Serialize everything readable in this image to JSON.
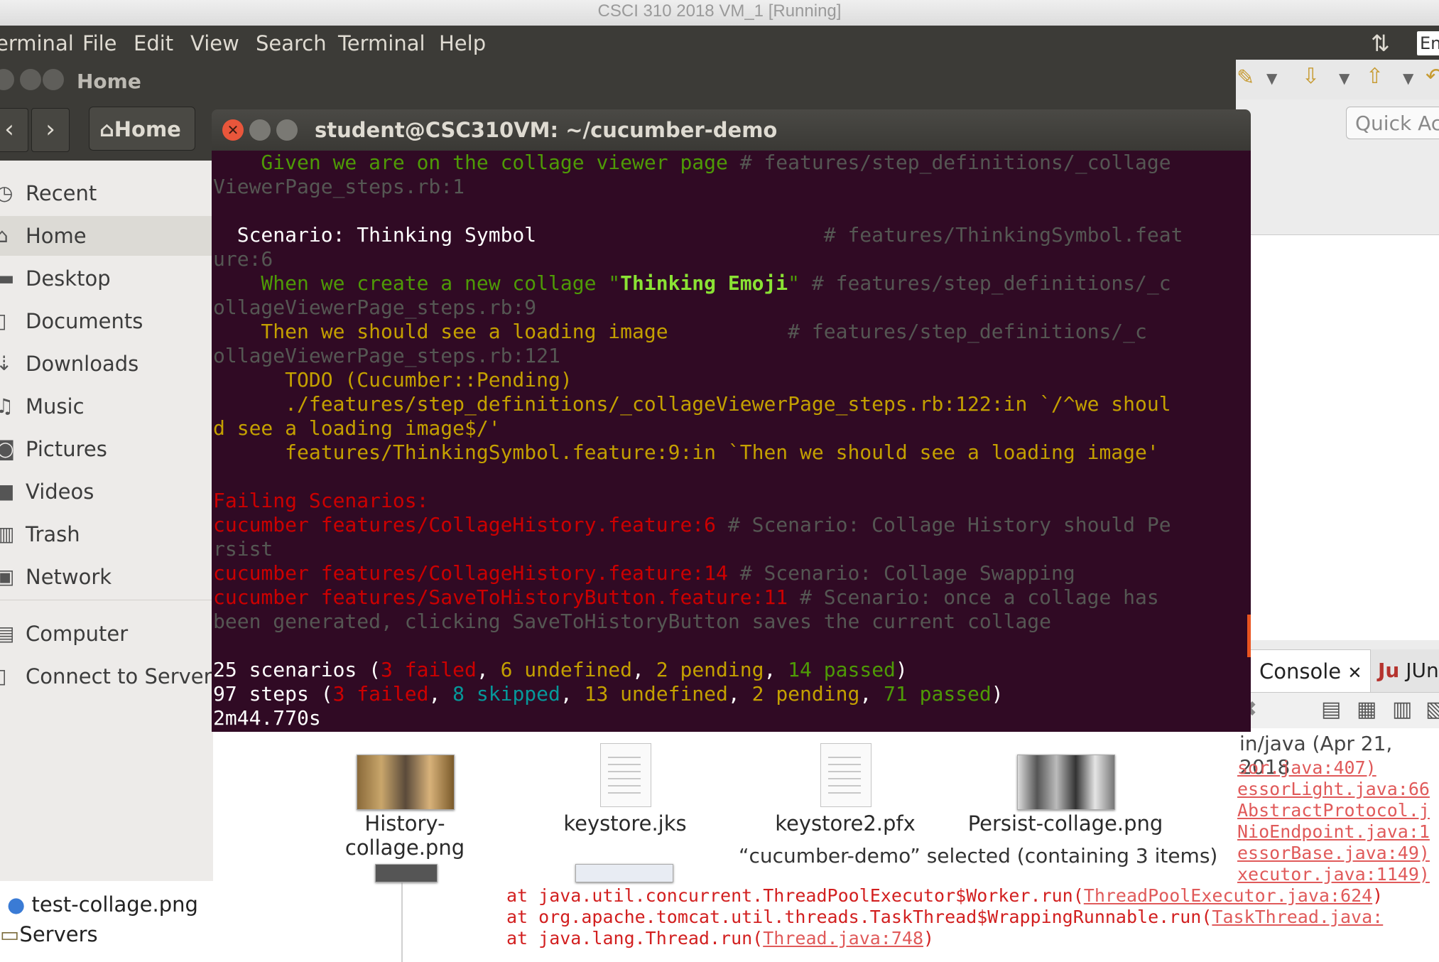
{
  "vm_title": "CSCI 310 2018 VM_1 [Running]",
  "menubar": {
    "items": [
      "erminal",
      "File",
      "Edit",
      "View",
      "Search",
      "Terminal",
      "Help"
    ],
    "keyboard_indicator": "En"
  },
  "nautilus": {
    "title": "Home",
    "breadcrumb": "Home",
    "sidebar": [
      {
        "label": "Recent",
        "icon": "clock-icon"
      },
      {
        "label": "Home",
        "icon": "home-icon",
        "active": true
      },
      {
        "label": "Desktop",
        "icon": "folder-icon"
      },
      {
        "label": "Documents",
        "icon": "document-icon"
      },
      {
        "label": "Downloads",
        "icon": "download-icon"
      },
      {
        "label": "Music",
        "icon": "music-icon"
      },
      {
        "label": "Pictures",
        "icon": "camera-icon"
      },
      {
        "label": "Videos",
        "icon": "video-icon"
      },
      {
        "label": "Trash",
        "icon": "trash-icon"
      },
      {
        "label": "Network",
        "icon": "network-icon"
      },
      {
        "label": "Computer",
        "icon": "computer-icon"
      },
      {
        "label": "Connect to Server",
        "icon": "server-icon"
      }
    ],
    "files": [
      "History-collage.png",
      "keystore.jks",
      "keystore2.pfx",
      "Persist-collage.png"
    ],
    "status": "“cucumber-demo” selected  (containing 3 items)"
  },
  "terminal": {
    "title": "student@CSC310VM: ~/cucumber-demo",
    "lines": {
      "l1a": "    Given we are on the collage viewer page ",
      "l1b": "# features/step_definitions/_collage",
      "l2": "ViewerPage_steps.rb:1",
      "l3a": "  Scenario: Thinking Symbol                        ",
      "l3b": "# features/ThinkingSymbol.feat",
      "l4": "ure:6",
      "l5a": "    When we create a new collage \"",
      "l5b": "Thinking Emoji",
      "l5c": "\" ",
      "l5d": "# features/step_definitions/_c",
      "l6": "ollageViewerPage_steps.rb:9",
      "l7a": "    Then we should see a loading image          ",
      "l7b": "# features/step_definitions/_c",
      "l8": "ollageViewerPage_steps.rb:121",
      "l9": "      TODO (Cucumber::Pending)",
      "l10": "      ./features/step_definitions/_collageViewerPage_steps.rb:122:in `/^we shoul",
      "l11": "d see a loading image$/'",
      "l12": "      features/ThinkingSymbol.feature:9:in `Then we should see a loading image'",
      "l13": "Failing Scenarios:",
      "l14a": "cucumber features/CollageHistory.feature:6 ",
      "l14b": "# Scenario: Collage History should Pe",
      "l15": "rsist",
      "l16a": "cucumber features/CollageHistory.feature:14 ",
      "l16b": "# Scenario: Collage Swapping",
      "l17a": "cucumber features/SaveToHistoryButton.feature:11 ",
      "l17b": "# Scenario: once a collage has",
      "l18": "been generated, clicking SaveToHistoryButton saves the current collage",
      "s1": "25 scenarios (",
      "s1_failed": "3 failed",
      "s1_sep1": ", ",
      "s1_undef": "6 undefined",
      "s1_sep2": ", ",
      "s1_pend": "2 pending",
      "s1_sep3": ", ",
      "s1_pass": "14 passed",
      "s1_end": ")",
      "s2": "97 steps (",
      "s2_failed": "3 failed",
      "s2_sep1": ", ",
      "s2_skip": "8 skipped",
      "s2_sep2": ", ",
      "s2_undef": "13 undefined",
      "s2_sep3": ", ",
      "s2_pend": "2 pending",
      "s2_sep4": ", ",
      "s2_pass": "71 passed",
      "s2_end": ")",
      "time": "2m44.770s"
    }
  },
  "eclipse": {
    "quick_access": "Quick Ac",
    "console_tab": "Console",
    "junit_tab": "JUn",
    "console_head": "in/java (Apr 21, 2018",
    "links": [
      "sor.java:407)",
      "essorLight.java:66",
      "AbstractProtocol.j",
      "NioEndpoint.java:1",
      "essorBase.java:49)",
      "xecutor.java:1149)"
    ],
    "stack": [
      {
        "pre": "at java.util.concurrent.ThreadPoolExecutor$Worker.run(",
        "link": "ThreadPoolExecutor.java:624",
        "post": ")"
      },
      {
        "pre": "at org.apache.tomcat.util.threads.TaskThread$WrappingRunnable.run(",
        "link": "TaskThread.java:",
        "post": ""
      },
      {
        "pre": "at java.lang.Thread.run(",
        "link": "Thread.java:748",
        "post": ")"
      }
    ],
    "explorer": [
      "test-collage.png",
      "Servers"
    ]
  }
}
